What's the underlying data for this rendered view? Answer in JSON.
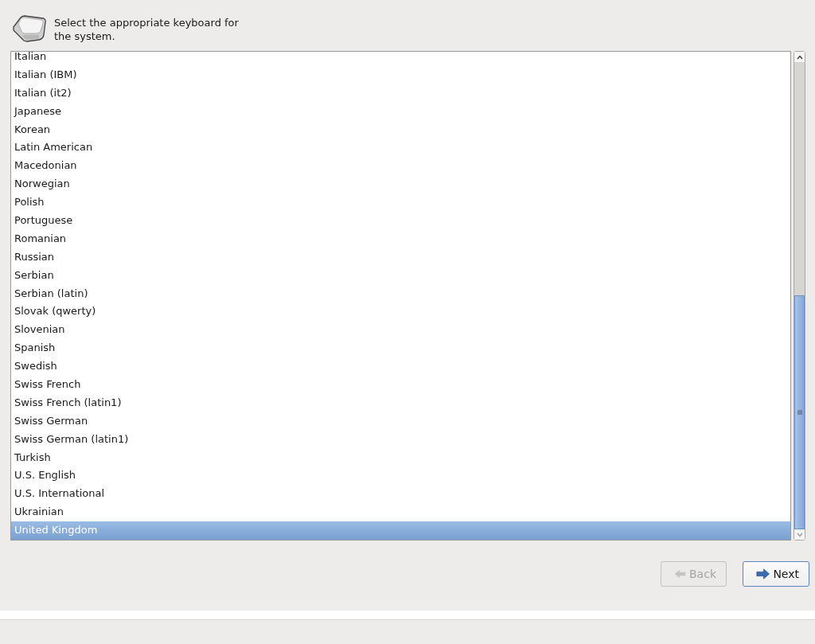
{
  "header": {
    "text": "Select the appropriate keyboard for the system."
  },
  "keyboard_list": {
    "items": [
      {
        "label": "Italian",
        "selected": false
      },
      {
        "label": "Italian (IBM)",
        "selected": false
      },
      {
        "label": "Italian (it2)",
        "selected": false
      },
      {
        "label": "Japanese",
        "selected": false
      },
      {
        "label": "Korean",
        "selected": false
      },
      {
        "label": "Latin American",
        "selected": false
      },
      {
        "label": "Macedonian",
        "selected": false
      },
      {
        "label": "Norwegian",
        "selected": false
      },
      {
        "label": "Polish",
        "selected": false
      },
      {
        "label": "Portuguese",
        "selected": false
      },
      {
        "label": "Romanian",
        "selected": false
      },
      {
        "label": "Russian",
        "selected": false
      },
      {
        "label": "Serbian",
        "selected": false
      },
      {
        "label": "Serbian (latin)",
        "selected": false
      },
      {
        "label": "Slovak (qwerty)",
        "selected": false
      },
      {
        "label": "Slovenian",
        "selected": false
      },
      {
        "label": "Spanish",
        "selected": false
      },
      {
        "label": "Swedish",
        "selected": false
      },
      {
        "label": "Swiss French",
        "selected": false
      },
      {
        "label": "Swiss French (latin1)",
        "selected": false
      },
      {
        "label": "Swiss German",
        "selected": false
      },
      {
        "label": "Swiss German (latin1)",
        "selected": false
      },
      {
        "label": "Turkish",
        "selected": false
      },
      {
        "label": "U.S. English",
        "selected": false
      },
      {
        "label": "U.S. International",
        "selected": false
      },
      {
        "label": "Ukrainian",
        "selected": false
      },
      {
        "label": "United Kingdom",
        "selected": true
      }
    ]
  },
  "buttons": [
    {
      "label": "Back",
      "kind": "back",
      "disabled": true
    },
    {
      "label": "Next",
      "kind": "next",
      "disabled": false
    }
  ]
}
